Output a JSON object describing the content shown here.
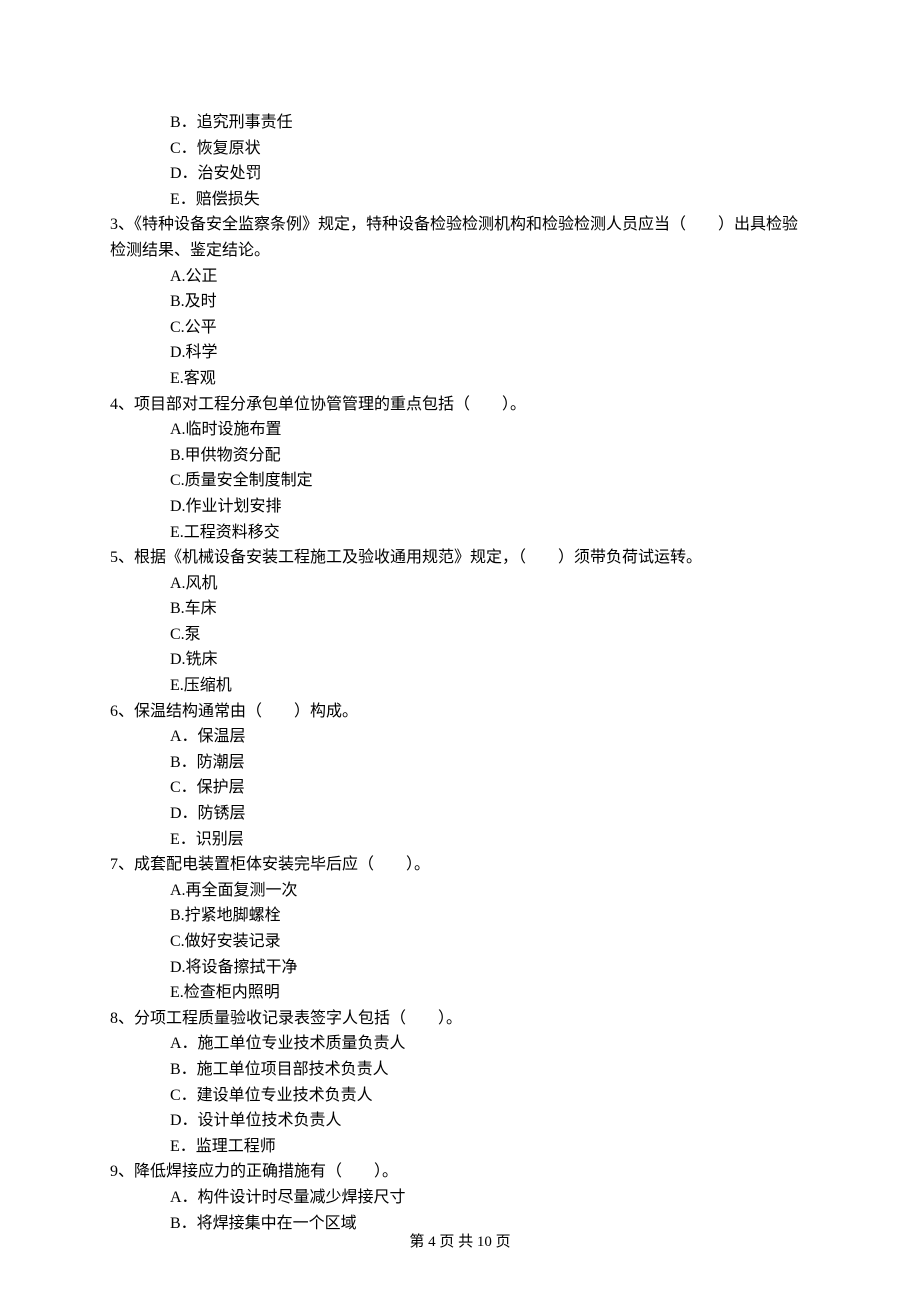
{
  "pre_options": [
    "B．追究刑事责任",
    "C．恢复原状",
    "D．治安处罚",
    "E．赔偿损失"
  ],
  "questions": [
    {
      "stem": "3、《特种设备安全监察条例》规定，特种设备检验检测机构和检验检测人员应当（　　）出具检验检测结果、鉴定结论。",
      "options": [
        "A.公正",
        "B.及时",
        "C.公平",
        "D.科学",
        "E.客观"
      ]
    },
    {
      "stem": "4、项目部对工程分承包单位协管管理的重点包括（　　）。",
      "options": [
        "A.临时设施布置",
        "B.甲供物资分配",
        "C.质量安全制度制定",
        "D.作业计划安排",
        "E.工程资料移交"
      ]
    },
    {
      "stem": "5、根据《机械设备安装工程施工及验收通用规范》规定，（　　）须带负荷试运转。",
      "options": [
        "A.风机",
        "B.车床",
        "C.泵",
        "D.铣床",
        "E.压缩机"
      ]
    },
    {
      "stem": "6、保温结构通常由（　　）构成。",
      "options": [
        "A．保温层",
        "B．防潮层",
        "C．保护层",
        "D．防锈层",
        "E．识别层"
      ]
    },
    {
      "stem": "7、成套配电装置柜体安装完毕后应（　　）。",
      "options": [
        "A.再全面复测一次",
        "B.拧紧地脚螺栓",
        "C.做好安装记录",
        "D.将设备擦拭干净",
        "E.检查柜内照明"
      ]
    },
    {
      "stem": "8、分项工程质量验收记录表签字人包括（　　）。",
      "options": [
        "A．施工单位专业技术质量负责人",
        "B．施工单位项目部技术负责人",
        "C．建设单位专业技术负责人",
        "D．设计单位技术负责人",
        "E．监理工程师"
      ]
    },
    {
      "stem": "9、降低焊接应力的正确措施有（　　）。",
      "options": [
        "A．构件设计时尽量减少焊接尺寸",
        "B．将焊接集中在一个区域"
      ]
    }
  ],
  "footer": "第 4 页 共 10 页"
}
